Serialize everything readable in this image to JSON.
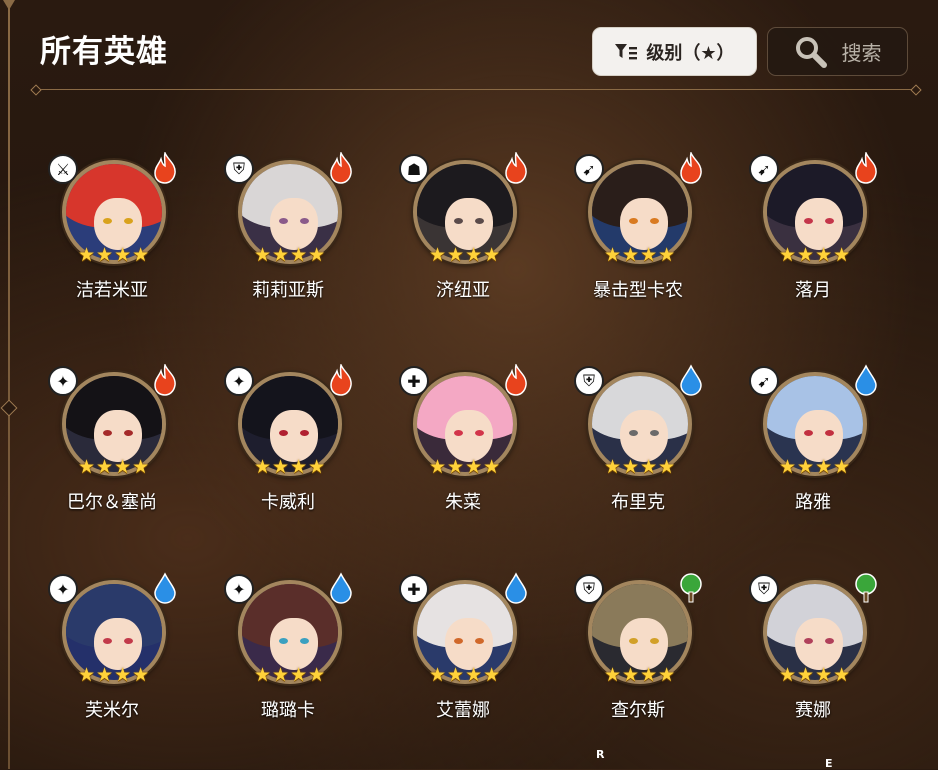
{
  "header": {
    "title": "所有英雄",
    "sort_label": "级别（★）",
    "search_label": "搜索"
  },
  "colors": {
    "fire": "#e8431d",
    "water": "#2a8fe6",
    "wood": "#3aa63a",
    "star": "#ffd23a"
  },
  "heroes": [
    {
      "name": "洁若米亚",
      "class": "sword-shield-icon",
      "element": "fire",
      "stars": 4,
      "hair": "#d7362c",
      "eye": "#d9a21c",
      "bg": "#2b3d7a"
    },
    {
      "name": "莉莉亚斯",
      "class": "shield-icon",
      "element": "fire",
      "stars": 4,
      "hair": "#d9d6d6",
      "eye": "#8a5a8a",
      "bg": "#3a3046"
    },
    {
      "name": "济纽亚",
      "class": "hooded-icon",
      "element": "fire",
      "stars": 4,
      "hair": "#1c1a1e",
      "eye": "#5a4a4a",
      "bg": "#3a3434"
    },
    {
      "name": "暴击型卡农",
      "class": "bow-icon",
      "element": "fire",
      "stars": 4,
      "hair": "#2a1e1a",
      "eye": "#d97a20",
      "bg": "#233a6a"
    },
    {
      "name": "落月",
      "class": "bow-icon",
      "element": "fire",
      "stars": 4,
      "hair": "#1c1a28",
      "eye": "#c4354a",
      "bg": "#3a3040"
    },
    {
      "name": "巴尔＆塞尚",
      "class": "wizard-hat-icon",
      "element": "fire",
      "stars": 4,
      "hair": "#141216",
      "eye": "#a52a2a",
      "bg": "#2a2a3a"
    },
    {
      "name": "卡威利",
      "class": "wizard-hat-icon",
      "element": "fire",
      "stars": 4,
      "hair": "#14141c",
      "eye": "#b02030",
      "bg": "#1e1e2e"
    },
    {
      "name": "朱菜",
      "class": "healer-icon",
      "element": "fire",
      "stars": 4,
      "hair": "#f4a8c4",
      "eye": "#d2344a",
      "bg": "#3a2a3a"
    },
    {
      "name": "布里克",
      "class": "shield-icon",
      "element": "water",
      "stars": 4,
      "hair": "#d8d8da",
      "eye": "#6a6a6a",
      "bg": "#2a3048"
    },
    {
      "name": "路雅",
      "class": "bow-icon",
      "element": "water",
      "stars": 4,
      "hair": "#a8c2e6",
      "eye": "#c23040",
      "bg": "#2a3450"
    },
    {
      "name": "芙米尔",
      "class": "wizard-hat-icon",
      "element": "water",
      "stars": 4,
      "hair": "#2a3a6a",
      "eye": "#c23a4a",
      "bg": "#24306a"
    },
    {
      "name": "璐璐卡",
      "class": "wizard-hat-icon",
      "element": "water",
      "stars": 4,
      "hair": "#5a2e2a",
      "eye": "#3aa0c0",
      "bg": "#3a2a4a"
    },
    {
      "name": "艾蕾娜",
      "class": "healer-icon",
      "element": "water",
      "stars": 4,
      "hair": "#e6e2e2",
      "eye": "#d0682a",
      "bg": "#2a3a6a"
    },
    {
      "name": "查尔斯",
      "class": "shield-icon",
      "element": "wood",
      "stars": 4,
      "hair": "#8a7a5a",
      "eye": "#d2a028",
      "bg": "#2a2a30"
    },
    {
      "name": "赛娜",
      "class": "shield-icon",
      "element": "wood",
      "stars": 4,
      "hair": "#d2d2d8",
      "eye": "#b0405a",
      "bg": "#2a3046"
    }
  ],
  "stray_marks": [
    "R",
    "E"
  ]
}
